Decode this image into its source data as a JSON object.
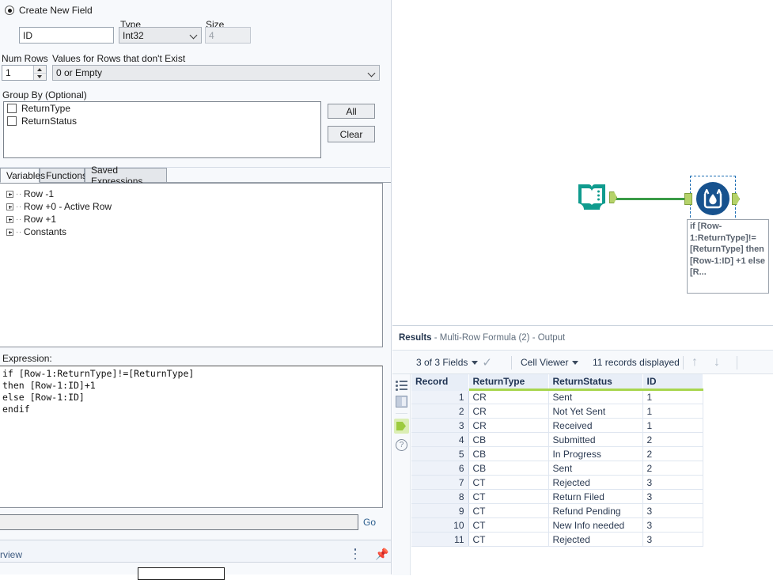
{
  "config": {
    "create_new_field": {
      "label": "Create New  Field",
      "selected": true
    },
    "field_name": {
      "value": "ID"
    },
    "type": {
      "label": "Type",
      "value": "Int32"
    },
    "size": {
      "label": "Size",
      "value": "4",
      "disabled": true
    },
    "num_rows": {
      "label": "Num Rows",
      "value": "1"
    },
    "values_for_rows": {
      "label": "Values for Rows that don't Exist",
      "value": "0 or Empty"
    },
    "group_by": {
      "label": "Group By (Optional)",
      "items": [
        {
          "label": "ReturnType",
          "checked": false
        },
        {
          "label": "ReturnStatus",
          "checked": false
        }
      ],
      "all_button": "All",
      "clear_button": "Clear"
    }
  },
  "tabs": [
    {
      "label": "Variables",
      "active": true
    },
    {
      "label": "Functions",
      "active": false
    },
    {
      "label": "Saved Expressions",
      "active": false
    }
  ],
  "variables_tree": [
    {
      "label": "Row -1"
    },
    {
      "label": "Row +0 - Active Row"
    },
    {
      "label": "Row +1"
    },
    {
      "label": "Constants"
    }
  ],
  "expression": {
    "label": "Expression:",
    "text": "if [Row-1:ReturnType]!=[ReturnType]\nthen [Row-1:ID]+1\nelse [Row-1:ID]\nendif"
  },
  "search": {
    "value": "",
    "go_label": "Go"
  },
  "overview": {
    "label": "rview"
  },
  "canvas": {
    "tools": [
      {
        "name": "text-input-tool",
        "icon": "book-icon"
      },
      {
        "name": "multi-row-formula-tool",
        "icon": "formula-container-icon",
        "selected": true
      }
    ],
    "annotation": "if [Row-1:ReturnType]!=[ReturnType] then [Row-1:ID] +1 else [R..."
  },
  "results": {
    "title_bold": "Results",
    "title_rest": " - Multi-Row Formula (2) - Output",
    "toolbar": {
      "fields_label": "3 of 3 Fields",
      "view_mode": "Cell Viewer",
      "records_label": "11 records displayed"
    },
    "side_icons": [
      {
        "name": "metadata-list-icon"
      },
      {
        "name": "panel-layout-icon"
      },
      {
        "name": "output-anchor-icon",
        "active": true
      },
      {
        "name": "help-icon"
      }
    ],
    "table": {
      "columns": [
        "Record",
        "ReturnType",
        "ReturnStatus",
        "ID"
      ],
      "rows": [
        [
          "1",
          "CR",
          "Sent",
          "1"
        ],
        [
          "2",
          "CR",
          "Not Yet Sent",
          "1"
        ],
        [
          "3",
          "CR",
          "Received",
          "1"
        ],
        [
          "4",
          "CB",
          "Submitted",
          "2"
        ],
        [
          "5",
          "CB",
          "In Progress",
          "2"
        ],
        [
          "6",
          "CB",
          "Sent",
          "2"
        ],
        [
          "7",
          "CT",
          "Rejected",
          "3"
        ],
        [
          "8",
          "CT",
          "Return Filed",
          "3"
        ],
        [
          "9",
          "CT",
          "Refund Pending",
          "3"
        ],
        [
          "10",
          "CT",
          "New Info needed",
          "3"
        ],
        [
          "11",
          "CT",
          "Rejected",
          "3"
        ]
      ]
    }
  },
  "colors": {
    "accent_green": "#a8d64f",
    "tool_teal": "#0f9b8e",
    "tool_blue": "#17528e",
    "connection_green": "#3a9b47"
  }
}
